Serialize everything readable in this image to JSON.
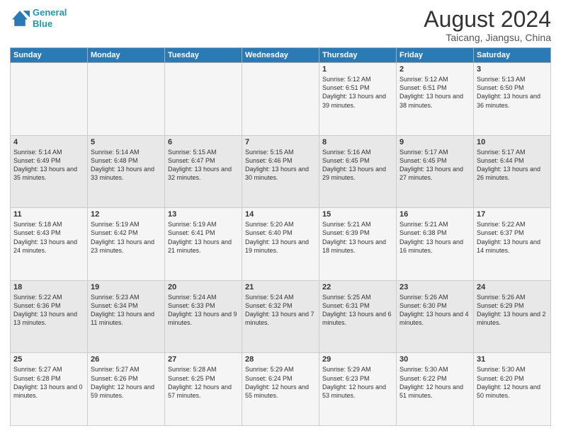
{
  "logo": {
    "line1": "General",
    "line2": "Blue"
  },
  "title": "August 2024",
  "subtitle": "Taicang, Jiangsu, China",
  "headers": [
    "Sunday",
    "Monday",
    "Tuesday",
    "Wednesday",
    "Thursday",
    "Friday",
    "Saturday"
  ],
  "weeks": [
    [
      {
        "day": "",
        "info": ""
      },
      {
        "day": "",
        "info": ""
      },
      {
        "day": "",
        "info": ""
      },
      {
        "day": "",
        "info": ""
      },
      {
        "day": "1",
        "info": "Sunrise: 5:12 AM\nSunset: 6:51 PM\nDaylight: 13 hours\nand 39 minutes."
      },
      {
        "day": "2",
        "info": "Sunrise: 5:12 AM\nSunset: 6:51 PM\nDaylight: 13 hours\nand 38 minutes."
      },
      {
        "day": "3",
        "info": "Sunrise: 5:13 AM\nSunset: 6:50 PM\nDaylight: 13 hours\nand 36 minutes."
      }
    ],
    [
      {
        "day": "4",
        "info": "Sunrise: 5:14 AM\nSunset: 6:49 PM\nDaylight: 13 hours\nand 35 minutes."
      },
      {
        "day": "5",
        "info": "Sunrise: 5:14 AM\nSunset: 6:48 PM\nDaylight: 13 hours\nand 33 minutes."
      },
      {
        "day": "6",
        "info": "Sunrise: 5:15 AM\nSunset: 6:47 PM\nDaylight: 13 hours\nand 32 minutes."
      },
      {
        "day": "7",
        "info": "Sunrise: 5:15 AM\nSunset: 6:46 PM\nDaylight: 13 hours\nand 30 minutes."
      },
      {
        "day": "8",
        "info": "Sunrise: 5:16 AM\nSunset: 6:45 PM\nDaylight: 13 hours\nand 29 minutes."
      },
      {
        "day": "9",
        "info": "Sunrise: 5:17 AM\nSunset: 6:45 PM\nDaylight: 13 hours\nand 27 minutes."
      },
      {
        "day": "10",
        "info": "Sunrise: 5:17 AM\nSunset: 6:44 PM\nDaylight: 13 hours\nand 26 minutes."
      }
    ],
    [
      {
        "day": "11",
        "info": "Sunrise: 5:18 AM\nSunset: 6:43 PM\nDaylight: 13 hours\nand 24 minutes."
      },
      {
        "day": "12",
        "info": "Sunrise: 5:19 AM\nSunset: 6:42 PM\nDaylight: 13 hours\nand 23 minutes."
      },
      {
        "day": "13",
        "info": "Sunrise: 5:19 AM\nSunset: 6:41 PM\nDaylight: 13 hours\nand 21 minutes."
      },
      {
        "day": "14",
        "info": "Sunrise: 5:20 AM\nSunset: 6:40 PM\nDaylight: 13 hours\nand 19 minutes."
      },
      {
        "day": "15",
        "info": "Sunrise: 5:21 AM\nSunset: 6:39 PM\nDaylight: 13 hours\nand 18 minutes."
      },
      {
        "day": "16",
        "info": "Sunrise: 5:21 AM\nSunset: 6:38 PM\nDaylight: 13 hours\nand 16 minutes."
      },
      {
        "day": "17",
        "info": "Sunrise: 5:22 AM\nSunset: 6:37 PM\nDaylight: 13 hours\nand 14 minutes."
      }
    ],
    [
      {
        "day": "18",
        "info": "Sunrise: 5:22 AM\nSunset: 6:36 PM\nDaylight: 13 hours\nand 13 minutes."
      },
      {
        "day": "19",
        "info": "Sunrise: 5:23 AM\nSunset: 6:34 PM\nDaylight: 13 hours\nand 11 minutes."
      },
      {
        "day": "20",
        "info": "Sunrise: 5:24 AM\nSunset: 6:33 PM\nDaylight: 13 hours\nand 9 minutes."
      },
      {
        "day": "21",
        "info": "Sunrise: 5:24 AM\nSunset: 6:32 PM\nDaylight: 13 hours\nand 7 minutes."
      },
      {
        "day": "22",
        "info": "Sunrise: 5:25 AM\nSunset: 6:31 PM\nDaylight: 13 hours\nand 6 minutes."
      },
      {
        "day": "23",
        "info": "Sunrise: 5:26 AM\nSunset: 6:30 PM\nDaylight: 13 hours\nand 4 minutes."
      },
      {
        "day": "24",
        "info": "Sunrise: 5:26 AM\nSunset: 6:29 PM\nDaylight: 13 hours\nand 2 minutes."
      }
    ],
    [
      {
        "day": "25",
        "info": "Sunrise: 5:27 AM\nSunset: 6:28 PM\nDaylight: 13 hours\nand 0 minutes."
      },
      {
        "day": "26",
        "info": "Sunrise: 5:27 AM\nSunset: 6:26 PM\nDaylight: 12 hours\nand 59 minutes."
      },
      {
        "day": "27",
        "info": "Sunrise: 5:28 AM\nSunset: 6:25 PM\nDaylight: 12 hours\nand 57 minutes."
      },
      {
        "day": "28",
        "info": "Sunrise: 5:29 AM\nSunset: 6:24 PM\nDaylight: 12 hours\nand 55 minutes."
      },
      {
        "day": "29",
        "info": "Sunrise: 5:29 AM\nSunset: 6:23 PM\nDaylight: 12 hours\nand 53 minutes."
      },
      {
        "day": "30",
        "info": "Sunrise: 5:30 AM\nSunset: 6:22 PM\nDaylight: 12 hours\nand 51 minutes."
      },
      {
        "day": "31",
        "info": "Sunrise: 5:30 AM\nSunset: 6:20 PM\nDaylight: 12 hours\nand 50 minutes."
      }
    ]
  ]
}
